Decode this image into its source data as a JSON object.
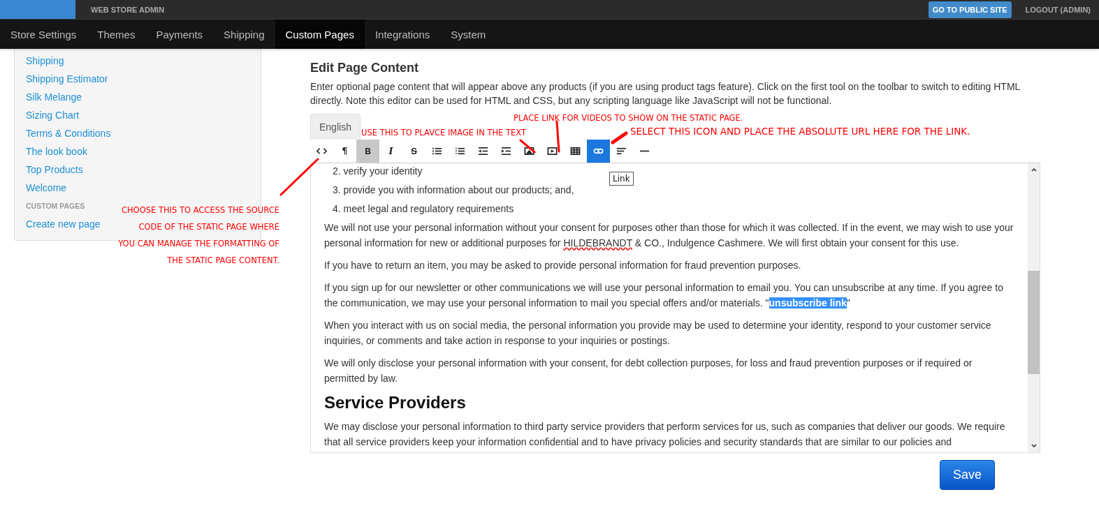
{
  "top_bar": {
    "title": "WEB STORE ADMIN",
    "public_site_button": "GO TO PUBLIC SITE",
    "logout_link": "LOGOUT (ADMIN)"
  },
  "nav_tabs": [
    {
      "label": "Store Settings",
      "selected": false
    },
    {
      "label": "Themes",
      "selected": false
    },
    {
      "label": "Payments",
      "selected": false
    },
    {
      "label": "Shipping",
      "selected": false
    },
    {
      "label": "Custom Pages",
      "selected": true
    },
    {
      "label": "Integrations",
      "selected": false
    },
    {
      "label": "System",
      "selected": false
    }
  ],
  "sidebar": {
    "items": [
      {
        "kind": "link",
        "label": "Shipping"
      },
      {
        "kind": "link",
        "label": "Shipping Estimator"
      },
      {
        "kind": "link",
        "label": "Silk Melange"
      },
      {
        "kind": "link",
        "label": "Sizing Chart"
      },
      {
        "kind": "link",
        "label": "Terms & Conditions"
      },
      {
        "kind": "link",
        "label": "The look book"
      },
      {
        "kind": "link",
        "label": "Top Products"
      },
      {
        "kind": "link",
        "label": "Welcome"
      },
      {
        "kind": "header",
        "label": "CUSTOM PAGES"
      },
      {
        "kind": "link",
        "label": "Create new page"
      }
    ]
  },
  "editor": {
    "heading": "Edit Page Content",
    "description": "Enter optional page content that will appear above any products (if you are using product tags feature). Click on the first tool on the toolbar to switch to editing HTML directly. Note this editor can be used for HTML and CSS, but any scripting language like JavaScript will not be functional.",
    "language_tab": "English",
    "toolbar": [
      {
        "kind": "source",
        "pressed": false,
        "selected": false
      },
      {
        "kind": "paragraph",
        "glyph": "¶",
        "pressed": false,
        "selected": false
      },
      {
        "kind": "bold",
        "glyph": "B",
        "pressed": true,
        "selected": false
      },
      {
        "kind": "italic",
        "glyph": "I",
        "pressed": false,
        "selected": false
      },
      {
        "kind": "strike",
        "glyph": "S",
        "pressed": false,
        "selected": false
      },
      {
        "kind": "bullets",
        "pressed": false,
        "selected": false
      },
      {
        "kind": "numbers",
        "pressed": false,
        "selected": false
      },
      {
        "kind": "outdent",
        "pressed": false,
        "selected": false
      },
      {
        "kind": "indent",
        "pressed": false,
        "selected": false
      },
      {
        "kind": "image",
        "pressed": false,
        "selected": false
      },
      {
        "kind": "video",
        "pressed": false,
        "selected": false
      },
      {
        "kind": "table",
        "pressed": false,
        "selected": false
      },
      {
        "kind": "link",
        "pressed": false,
        "selected": true
      },
      {
        "kind": "align",
        "pressed": false,
        "selected": false
      },
      {
        "kind": "rule",
        "pressed": false,
        "selected": false
      }
    ],
    "tooltip": "Link",
    "content": [
      {
        "kind": "list_item",
        "number": "2.",
        "parts": [
          {
            "kind": "plain",
            "text": "verify your identity"
          }
        ]
      },
      {
        "kind": "list_item",
        "number": "3.",
        "parts": [
          {
            "kind": "plain",
            "text": "provide you with information about our products; and,"
          }
        ]
      },
      {
        "kind": "list_item",
        "number": "4.",
        "parts": [
          {
            "kind": "plain",
            "text": "meet legal and regulatory requirements"
          }
        ]
      },
      {
        "kind": "paragraph",
        "parts": [
          {
            "kind": "plain",
            "text": "We will not use your personal information without your consent for purposes other than those for which it was collected. If in the event, we may wish to use your personal information for new or additional purposes for "
          },
          {
            "kind": "misspelled",
            "text": "HILDEBRANDT"
          },
          {
            "kind": "plain",
            "text": " & CO., Indulgence Cashmere. We will first obtain your consent for this use."
          }
        ]
      },
      {
        "kind": "paragraph",
        "parts": [
          {
            "kind": "plain",
            "text": "If you have to return an item, you may be asked to provide personal information for fraud prevention purposes."
          }
        ]
      },
      {
        "kind": "paragraph",
        "parts": [
          {
            "kind": "plain",
            "text": "If you sign up for our newsletter or other communications we will use your personal information to email you. You can unsubscribe at any time. If you agree to the communication, we may use your personal information to mail you special offers and/or materials. \""
          },
          {
            "kind": "selected",
            "text": "unsubscribe link"
          },
          {
            "kind": "plain",
            "text": "\""
          }
        ]
      },
      {
        "kind": "paragraph",
        "parts": [
          {
            "kind": "plain",
            "text": "When you interact with us on social media, the personal information you provide may be used to determine your identity, respond to your customer service inquiries, or comments and take action in response to your inquiries or postings."
          }
        ]
      },
      {
        "kind": "paragraph",
        "parts": [
          {
            "kind": "plain",
            "text": "We will only disclose your personal information with your consent, for debt collection purposes, for loss and fraud prevention purposes or if required or permitted by law."
          }
        ]
      },
      {
        "kind": "heading",
        "parts": [
          {
            "kind": "plain",
            "text": "Service Providers"
          }
        ]
      },
      {
        "kind": "paragraph",
        "parts": [
          {
            "kind": "plain",
            "text": "We may disclose your personal information to third party service providers that perform services for us, such as companies that deliver our goods. We require that all service providers keep your information confidential and to have privacy policies and security standards that are similar to our policies and"
          }
        ]
      }
    ],
    "save_button": "Save"
  },
  "annotations": [
    {
      "kind": "image",
      "text": "USE THIS TO PLAVCE IMAGE IN THE TEXT"
    },
    {
      "kind": "video",
      "text": "PLACE LINK FOR VIDEOS TO SHOW ON THE STATIC PAGE."
    },
    {
      "kind": "link",
      "text": "SELECT THIS ICON AND PLACE THE ABSOLUTE URL HERE FOR THE LINK."
    },
    {
      "kind": "source",
      "lines": [
        "CHOOSE THIS TO ACCESS THE SOURCE",
        "CODE OF THE STATIC PAGE WHERE",
        "YOU CAN MANAGE THE FORMATTING OF",
        "THE STATIC PAGE CONTENT."
      ]
    }
  ]
}
